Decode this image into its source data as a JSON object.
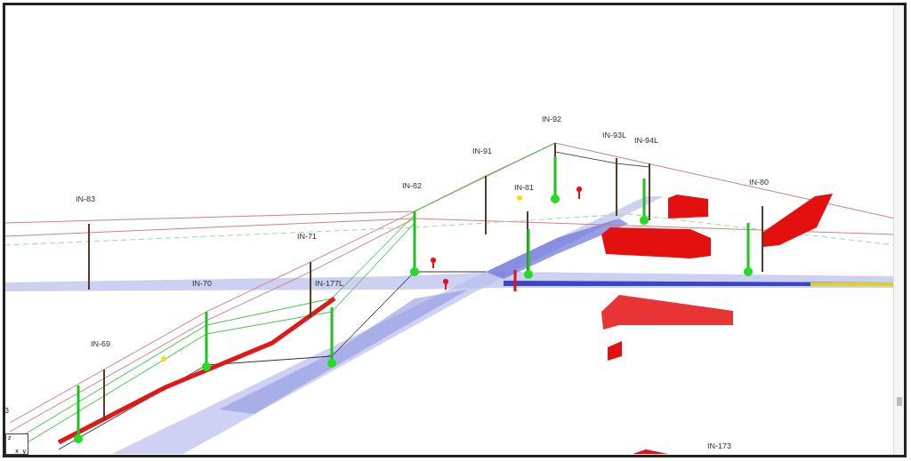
{
  "viewport": {
    "pole_labels": [
      {
        "text": "IN-92"
      },
      {
        "text": "IN-91"
      },
      {
        "text": "IN-93L"
      },
      {
        "text": "IN-94L"
      },
      {
        "text": "IN-82"
      },
      {
        "text": "IN-81"
      },
      {
        "text": "IN-80"
      },
      {
        "text": "IN-83"
      },
      {
        "text": "IN-71"
      },
      {
        "text": "IN-70"
      },
      {
        "text": "IN-177L"
      },
      {
        "text": "IN-69"
      },
      {
        "text": "IN-173"
      },
      {
        "text": "3"
      }
    ],
    "axis_labels": [
      "z",
      "x",
      "y"
    ]
  }
}
